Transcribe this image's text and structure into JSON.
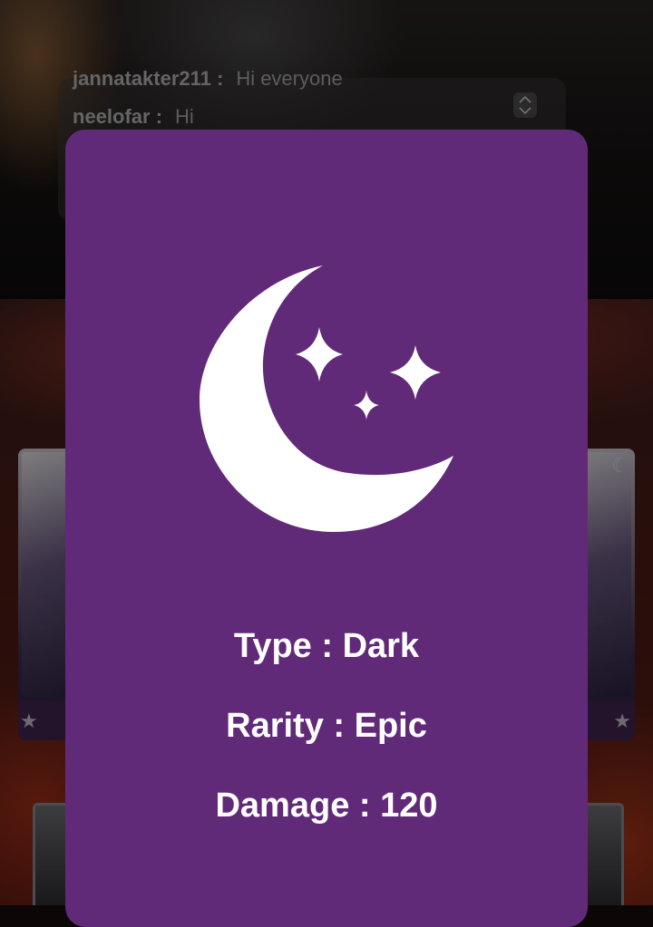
{
  "chat": {
    "messages": [
      {
        "user": "jannatakter211 :",
        "text": "Hi everyone"
      },
      {
        "user": "neelofar :",
        "text": "Hi"
      }
    ]
  },
  "card_detail": {
    "icon": "crescent-moon-stars-icon",
    "type_line": "Type : Dark",
    "rarity_line": "Rarity : Epic",
    "damage_line": "Damage : 120"
  },
  "colors": {
    "modal_background": "#612a78",
    "text": "#ffffff"
  },
  "side_cards": {
    "left_icon": "star-icon",
    "right_icons": [
      "moon-icon",
      "star-icon"
    ]
  }
}
